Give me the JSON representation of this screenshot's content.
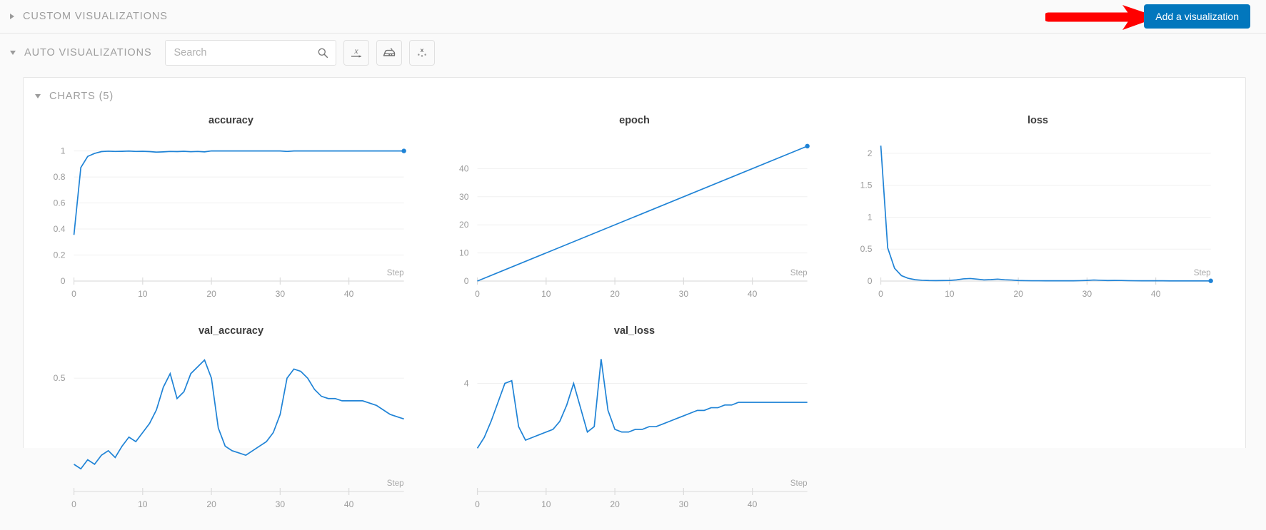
{
  "sections": {
    "custom": {
      "label": "CUSTOM VISUALIZATIONS",
      "expanded": false,
      "chevron_icon": "chevron-right-icon",
      "add_button_label": "Add a visualization",
      "accent_color": "#0277bd",
      "annotation_color": "#ff0000"
    },
    "auto": {
      "label": "AUTO VISUALIZATIONS",
      "expanded": true,
      "chevron_icon": "chevron-down-icon",
      "search": {
        "placeholder": "Search",
        "value": "",
        "icon": "search-icon"
      },
      "tools": [
        {
          "name": "x-axis-button",
          "icon": "x-axis-icon",
          "glyph": "x"
        },
        {
          "name": "smoothing-button",
          "icon": "iron-icon",
          "glyph": "iron"
        },
        {
          "name": "outliers-button",
          "icon": "scatter-outlier-icon",
          "glyph": "scatter"
        }
      ]
    }
  },
  "charts_panel": {
    "label": "CHARTS (5)",
    "count": 5,
    "expanded": true,
    "chevron_icon": "chevron-down-icon"
  },
  "chart_data": [
    {
      "type": "line",
      "title": "accuracy",
      "xlabel": "Step",
      "ylabel": "",
      "xlim": [
        0,
        48
      ],
      "ylim": [
        0,
        1.08
      ],
      "xticks": [
        0,
        10,
        20,
        30,
        40
      ],
      "yticks": [
        0,
        0.2,
        0.4,
        0.6,
        0.8,
        1
      ],
      "ytick_labels": [
        "0",
        "0.2",
        "0.4",
        "0.6",
        "0.8",
        "1"
      ],
      "grid": true,
      "legend": "none",
      "color": "#1f83d6",
      "end_marker": true,
      "x": [
        0,
        1,
        2,
        3,
        4,
        5,
        6,
        7,
        8,
        9,
        10,
        11,
        12,
        13,
        14,
        15,
        16,
        17,
        18,
        19,
        20,
        21,
        22,
        23,
        24,
        25,
        26,
        27,
        28,
        29,
        30,
        31,
        32,
        33,
        34,
        35,
        36,
        37,
        38,
        39,
        40,
        41,
        42,
        43,
        44,
        45,
        46,
        47,
        48
      ],
      "y": [
        0.355,
        0.872,
        0.958,
        0.981,
        0.995,
        0.998,
        0.996,
        0.997,
        0.999,
        0.996,
        0.997,
        0.995,
        0.991,
        0.993,
        0.996,
        0.995,
        0.997,
        0.994,
        0.996,
        0.993,
        1.0,
        1.0,
        1.0,
        1.0,
        1.0,
        1.0,
        1.0,
        1.0,
        1.0,
        1.0,
        1.0,
        0.996,
        1.0,
        1.0,
        1.0,
        1.0,
        1.0,
        1.0,
        1.0,
        1.0,
        1.0,
        1.0,
        1.0,
        1.0,
        1.0,
        1.0,
        1.0,
        1.0,
        1.0
      ]
    },
    {
      "type": "line",
      "title": "epoch",
      "xlabel": "Step",
      "ylabel": "",
      "xlim": [
        0,
        48
      ],
      "ylim": [
        0,
        50
      ],
      "xticks": [
        0,
        10,
        20,
        30,
        40
      ],
      "yticks": [
        0,
        10,
        20,
        30,
        40
      ],
      "ytick_labels": [
        "0",
        "10",
        "20",
        "30",
        "40"
      ],
      "grid": true,
      "legend": "none",
      "color": "#1f83d6",
      "end_marker": true,
      "x": [
        0,
        48
      ],
      "y": [
        0,
        48
      ]
    },
    {
      "type": "line",
      "title": "loss",
      "xlabel": "Step",
      "ylabel": "",
      "xlim": [
        0,
        48
      ],
      "ylim": [
        0,
        2.2
      ],
      "xticks": [
        0,
        10,
        20,
        30,
        40
      ],
      "yticks": [
        0,
        0.5,
        1,
        1.5,
        2
      ],
      "ytick_labels": [
        "0",
        "0.5",
        "1",
        "1.5",
        "2"
      ],
      "grid": true,
      "legend": "none",
      "color": "#1f83d6",
      "end_marker": true,
      "x": [
        0,
        1,
        2,
        3,
        4,
        5,
        6,
        7,
        8,
        9,
        10,
        11,
        12,
        13,
        14,
        15,
        16,
        17,
        18,
        19,
        20,
        21,
        22,
        23,
        24,
        25,
        26,
        27,
        28,
        29,
        30,
        31,
        32,
        33,
        34,
        35,
        36,
        37,
        38,
        39,
        40,
        41,
        42,
        43,
        44,
        45,
        46,
        47,
        48
      ],
      "y": [
        2.12,
        0.52,
        0.2,
        0.085,
        0.042,
        0.021,
        0.012,
        0.008,
        0.007,
        0.008,
        0.01,
        0.018,
        0.034,
        0.04,
        0.03,
        0.018,
        0.022,
        0.03,
        0.02,
        0.016,
        0.008,
        0.006,
        0.005,
        0.005,
        0.004,
        0.004,
        0.004,
        0.004,
        0.004,
        0.006,
        0.01,
        0.016,
        0.012,
        0.008,
        0.01,
        0.009,
        0.006,
        0.005,
        0.004,
        0.004,
        0.004,
        0.004,
        0.003,
        0.003,
        0.003,
        0.003,
        0.003,
        0.003,
        0.003
      ]
    },
    {
      "type": "line",
      "title": "val_accuracy",
      "xlabel": "Step",
      "ylabel": "",
      "xlim": [
        0,
        48
      ],
      "ylim": [
        0,
        0.62
      ],
      "xticks": [
        0,
        10,
        20,
        30,
        40
      ],
      "yticks": [
        0.5
      ],
      "ytick_labels": [
        "0.5"
      ],
      "grid": true,
      "legend": "none",
      "color": "#1f83d6",
      "end_marker": false,
      "x": [
        0,
        1,
        2,
        3,
        4,
        5,
        6,
        7,
        8,
        9,
        10,
        11,
        12,
        13,
        14,
        15,
        16,
        17,
        18,
        19,
        20,
        21,
        22,
        23,
        24,
        25,
        26,
        27,
        28,
        29,
        30,
        31,
        32,
        33,
        34,
        35,
        36,
        37,
        38,
        39,
        40,
        41,
        42,
        43,
        44,
        45,
        46,
        47,
        48
      ],
      "y": [
        0.12,
        0.1,
        0.14,
        0.12,
        0.16,
        0.18,
        0.15,
        0.2,
        0.24,
        0.22,
        0.26,
        0.3,
        0.36,
        0.46,
        0.52,
        0.41,
        0.44,
        0.52,
        0.55,
        0.58,
        0.5,
        0.28,
        0.2,
        0.18,
        0.17,
        0.16,
        0.18,
        0.2,
        0.22,
        0.26,
        0.34,
        0.5,
        0.54,
        0.53,
        0.5,
        0.45,
        0.42,
        0.41,
        0.41,
        0.4,
        0.4,
        0.4,
        0.4,
        0.39,
        0.38,
        0.36,
        0.34,
        0.33,
        0.32
      ]
    },
    {
      "type": "line",
      "title": "val_loss",
      "xlabel": "Step",
      "ylabel": "",
      "xlim": [
        0,
        48
      ],
      "ylim": [
        0,
        5.2
      ],
      "xticks": [
        0,
        10,
        20,
        30,
        40
      ],
      "yticks": [
        4
      ],
      "ytick_labels": [
        "4"
      ],
      "grid": true,
      "legend": "none",
      "color": "#1f83d6",
      "end_marker": false,
      "x": [
        0,
        1,
        2,
        3,
        4,
        5,
        6,
        7,
        8,
        9,
        10,
        11,
        12,
        13,
        14,
        15,
        16,
        17,
        18,
        19,
        20,
        21,
        22,
        23,
        24,
        25,
        26,
        27,
        28,
        29,
        30,
        31,
        32,
        33,
        34,
        35,
        36,
        37,
        38,
        39,
        40,
        41,
        42,
        43,
        44,
        45,
        46,
        47,
        48
      ],
      "y": [
        1.6,
        2.0,
        2.6,
        3.3,
        4.0,
        4.1,
        2.4,
        1.9,
        2.0,
        2.1,
        2.2,
        2.3,
        2.6,
        3.2,
        4.0,
        3.1,
        2.2,
        2.4,
        4.9,
        3.0,
        2.3,
        2.2,
        2.2,
        2.3,
        2.3,
        2.4,
        2.4,
        2.5,
        2.6,
        2.7,
        2.8,
        2.9,
        3.0,
        3.0,
        3.1,
        3.1,
        3.2,
        3.2,
        3.3,
        3.3,
        3.3,
        3.3,
        3.3,
        3.3,
        3.3,
        3.3,
        3.3,
        3.3,
        3.3
      ]
    }
  ]
}
